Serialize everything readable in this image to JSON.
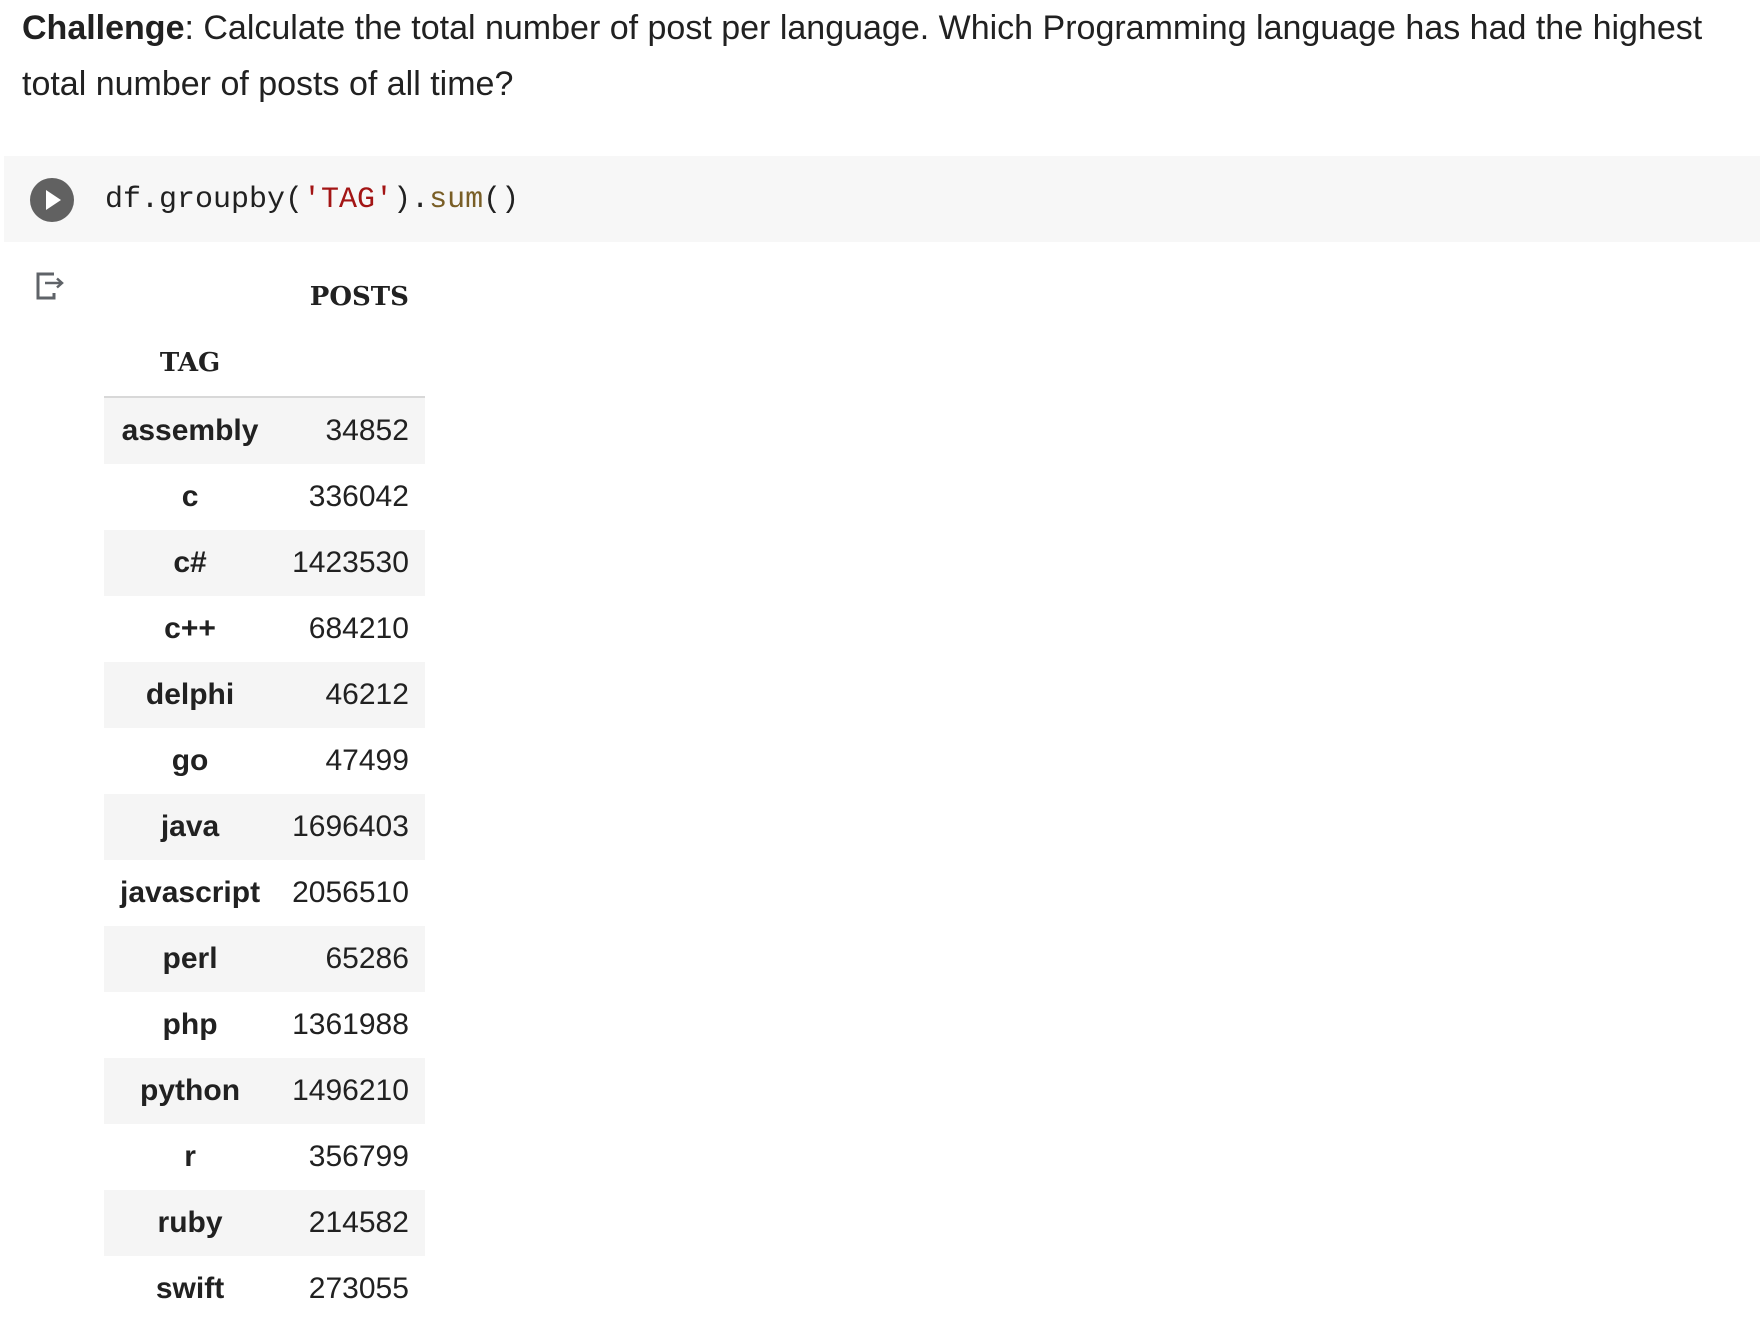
{
  "markdown": {
    "label": "Challenge",
    "text": ": Calculate the total number of post per language. Which Programming language has had the highest total number of posts of all time?"
  },
  "code_cell": {
    "run_icon": "play-icon",
    "tokens": [
      {
        "text": "df.groupby(",
        "kind": "plain"
      },
      {
        "text": "'TAG'",
        "kind": "string"
      },
      {
        "text": ").",
        "kind": "plain"
      },
      {
        "text": "sum",
        "kind": "function"
      },
      {
        "text": "()",
        "kind": "plain"
      }
    ]
  },
  "output": {
    "icon": "output-redirect-icon",
    "table": {
      "column_name": "POSTS",
      "index_name": "TAG",
      "rows": [
        {
          "tag": "assembly",
          "posts": "34852"
        },
        {
          "tag": "c",
          "posts": "336042"
        },
        {
          "tag": "c#",
          "posts": "1423530"
        },
        {
          "tag": "c++",
          "posts": "684210"
        },
        {
          "tag": "delphi",
          "posts": "46212"
        },
        {
          "tag": "go",
          "posts": "47499"
        },
        {
          "tag": "java",
          "posts": "1696403"
        },
        {
          "tag": "javascript",
          "posts": "2056510"
        },
        {
          "tag": "perl",
          "posts": "65286"
        },
        {
          "tag": "php",
          "posts": "1361988"
        },
        {
          "tag": "python",
          "posts": "1496210"
        },
        {
          "tag": "r",
          "posts": "356799"
        },
        {
          "tag": "ruby",
          "posts": "214582"
        },
        {
          "tag": "swift",
          "posts": "273055"
        }
      ]
    }
  }
}
